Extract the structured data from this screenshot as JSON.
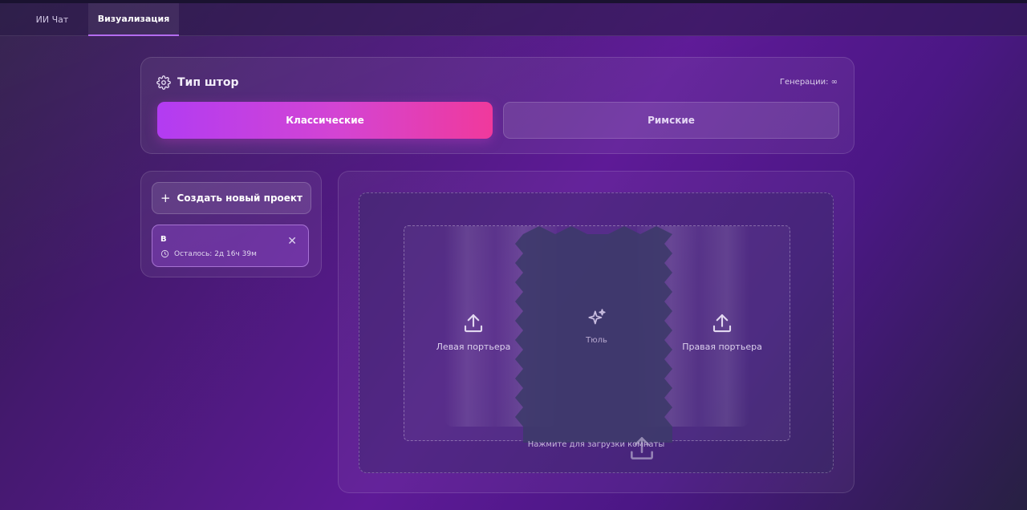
{
  "tabs": [
    {
      "label": "ИИ Чат",
      "active": false
    },
    {
      "label": "Визуализация",
      "active": true
    }
  ],
  "curtain_type": {
    "title": "Тип штор",
    "icon": "gear-icon",
    "generations_label": "Генерации: ∞",
    "options": [
      {
        "label": "Классические",
        "selected": true
      },
      {
        "label": "Римские",
        "selected": false
      }
    ]
  },
  "projects": {
    "create_label": "Создать новый проект",
    "items": [
      {
        "name": "В",
        "remaining": "Осталось: 2д 16ч 39м"
      }
    ]
  },
  "upload": {
    "left_drape_label": "Левая портьера",
    "tulle_label": "Тюль",
    "right_drape_label": "Правая портьера",
    "room_hint": "Нажмите для загрузки комнаты"
  },
  "colors": {
    "accent_start": "#b23cf2",
    "accent_end": "#f0399c",
    "background": "#5e1a97"
  }
}
